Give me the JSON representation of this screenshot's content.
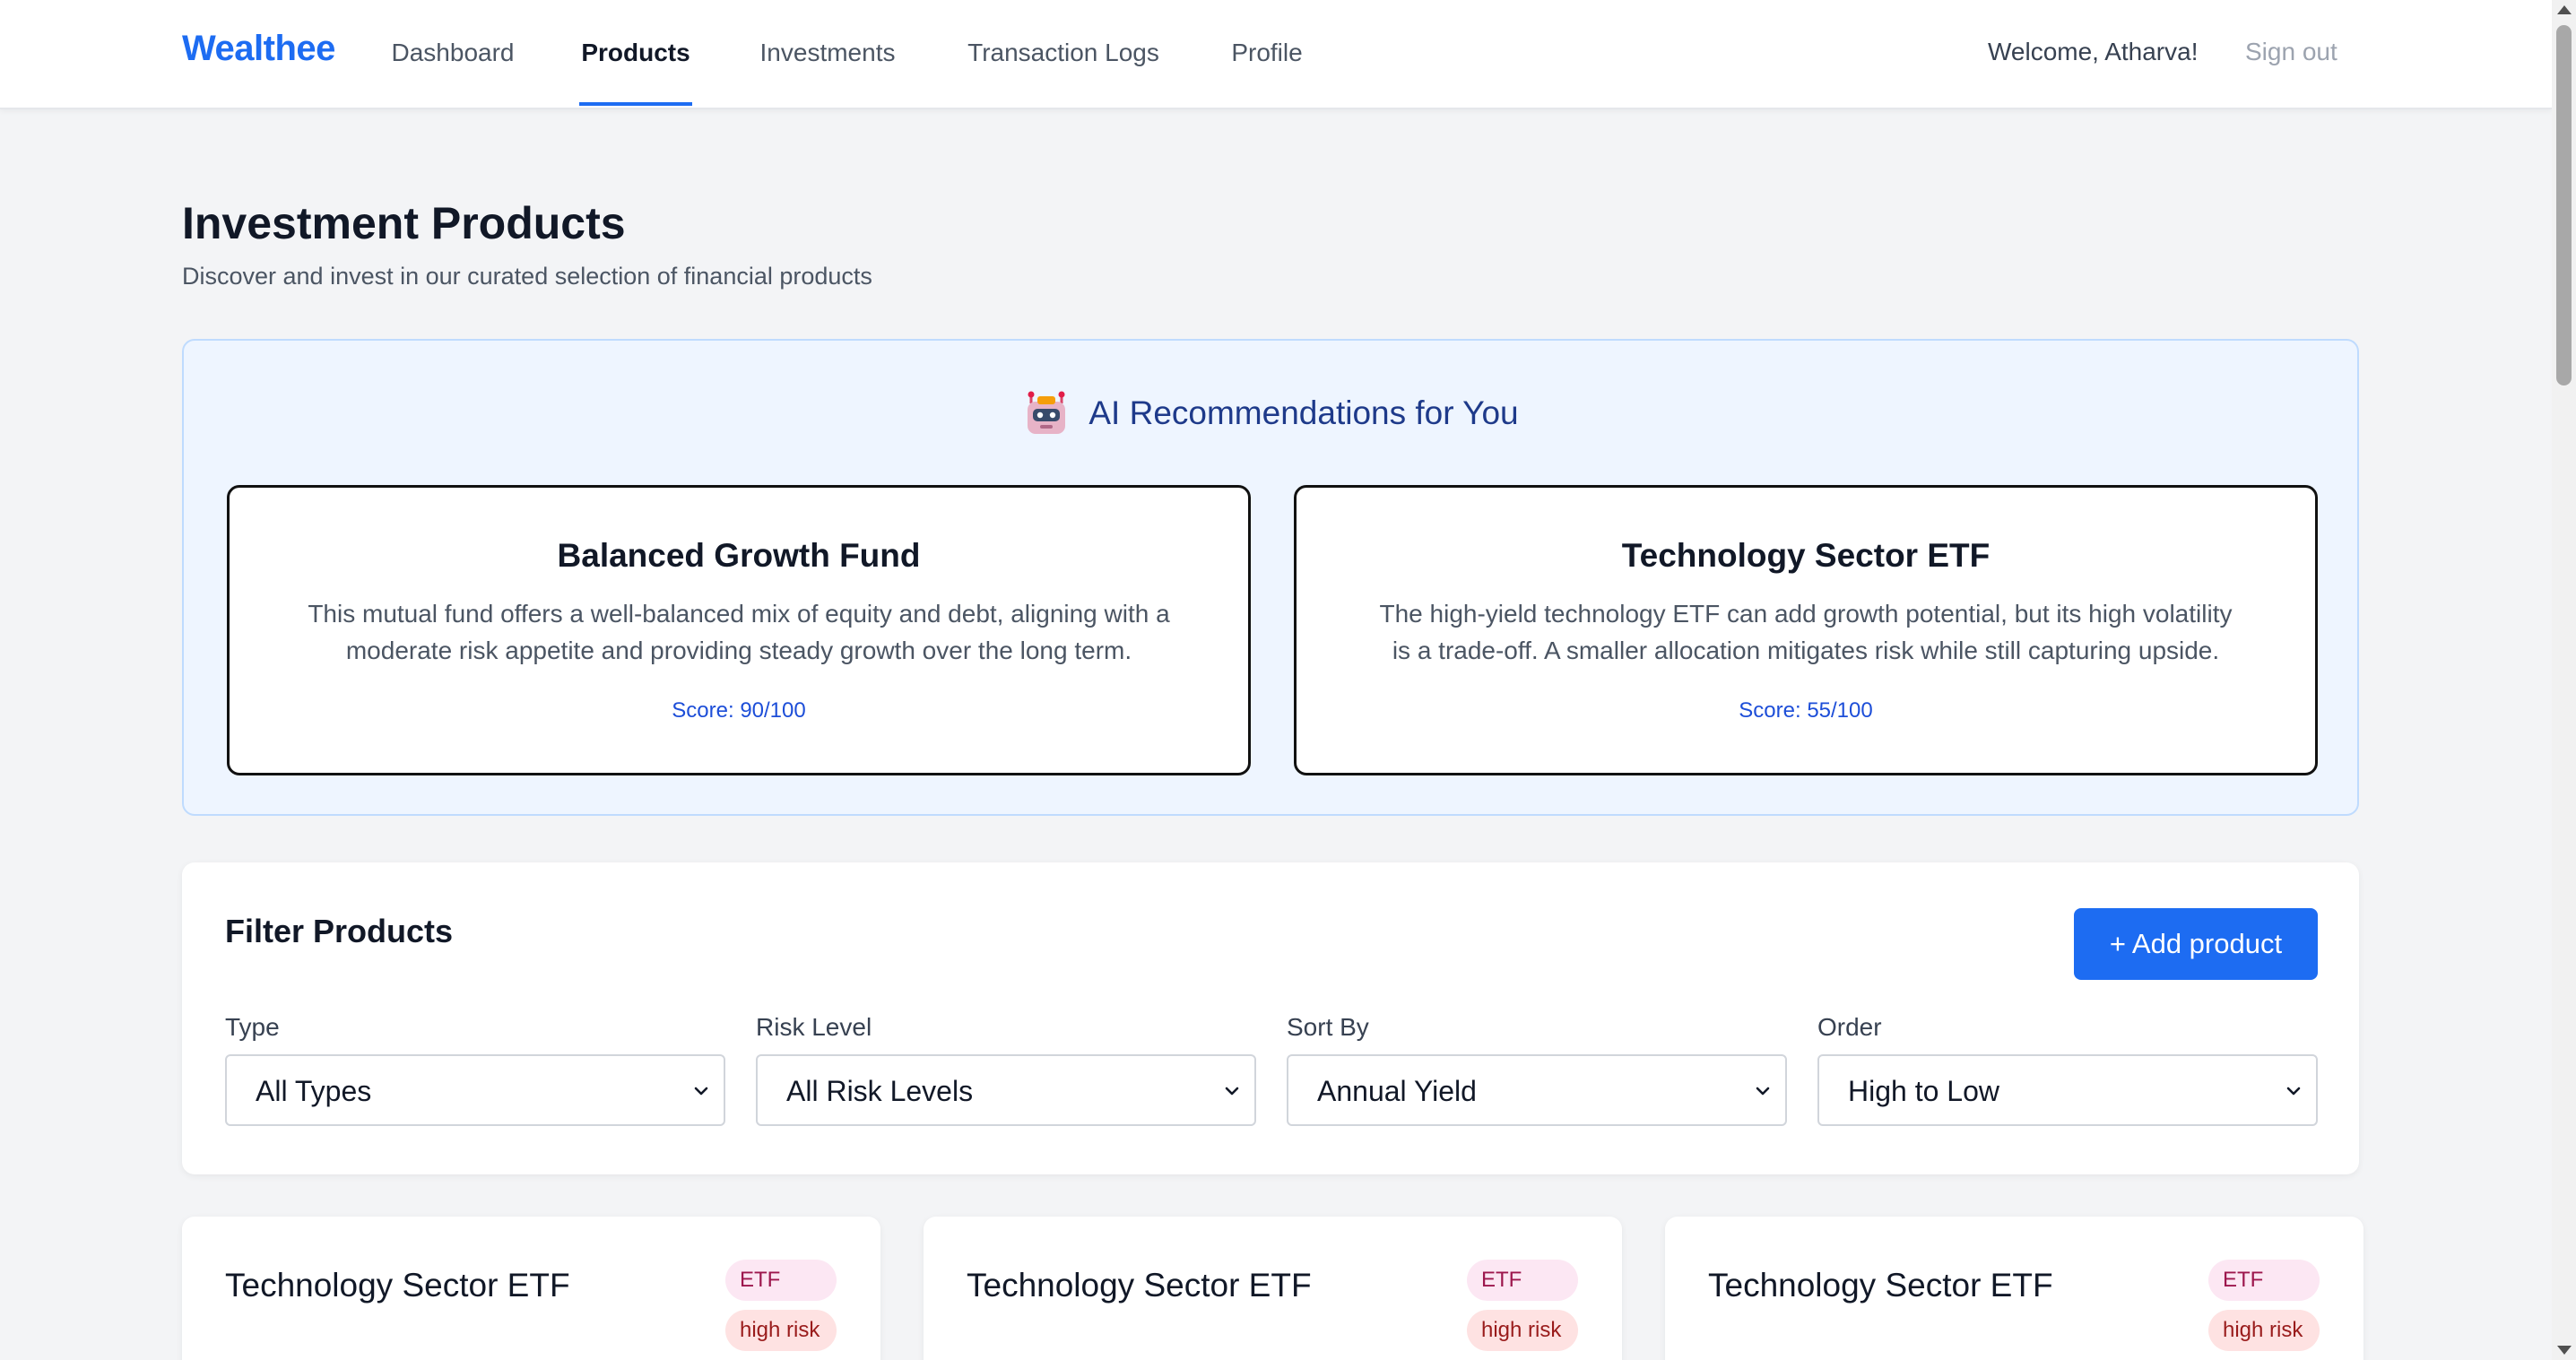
{
  "nav": {
    "brand": "Wealthee",
    "links": [
      {
        "label": "Dashboard",
        "active": false
      },
      {
        "label": "Products",
        "active": true
      },
      {
        "label": "Investments",
        "active": false
      },
      {
        "label": "Transaction Logs",
        "active": false
      },
      {
        "label": "Profile",
        "active": false
      }
    ],
    "welcome": "Welcome, Atharva!",
    "signout": "Sign out"
  },
  "header": {
    "title": "Investment Products",
    "subtitle": "Discover and invest in our curated selection of financial products"
  },
  "ai": {
    "icon": "robot-icon",
    "title": "AI Recommendations for You",
    "recommendations": [
      {
        "name": "Balanced Growth Fund",
        "description": "This mutual fund offers a well-balanced mix of equity and debt, aligning with a moderate risk appetite and providing steady growth over the long term.",
        "score": "Score: 90/100"
      },
      {
        "name": "Technology Sector ETF",
        "description": "The high-yield technology ETF can add growth potential, but its high volatility is a trade-off. A smaller allocation mitigates risk while still capturing upside.",
        "score": "Score: 55/100"
      }
    ]
  },
  "filters": {
    "title": "Filter Products",
    "add_button": "+ Add product",
    "fields": [
      {
        "label": "Type",
        "value": "All Types"
      },
      {
        "label": "Risk Level",
        "value": "All Risk Levels"
      },
      {
        "label": "Sort By",
        "value": "Annual Yield"
      },
      {
        "label": "Order",
        "value": "High to Low"
      }
    ]
  },
  "products": [
    {
      "name": "Technology Sector ETF",
      "type": "ETF",
      "risk": "high risk"
    },
    {
      "name": "Technology Sector ETF",
      "type": "ETF",
      "risk": "high risk"
    },
    {
      "name": "Technology Sector ETF",
      "type": "ETF",
      "risk": "high risk"
    }
  ],
  "colors": {
    "accent": "#1d6cf2",
    "ai_panel_bg": "#eef5ff",
    "badge_type_bg": "#fce7f3",
    "badge_risk_bg": "#fee2e2"
  }
}
